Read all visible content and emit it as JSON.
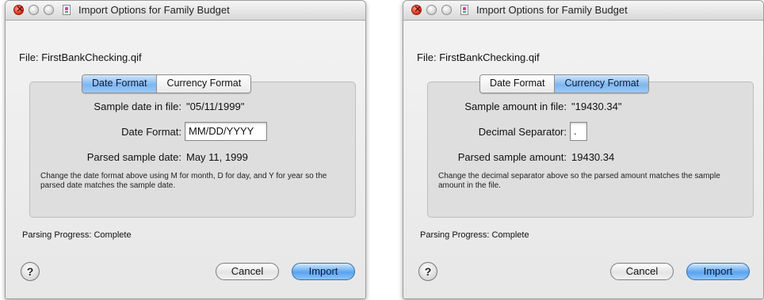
{
  "left_window": {
    "title": "Import Options for Family Budget",
    "file_label": "File:",
    "file_name": "FirstBankChecking.qif",
    "tabs": [
      "Date Format",
      "Currency Format"
    ],
    "active_tab": "Date Format",
    "sample_label": "Sample date in file:",
    "sample_value": "\"05/11/1999\"",
    "format_label": "Date Format:",
    "format_value": "MM/DD/YYYY",
    "parsed_label": "Parsed sample date:",
    "parsed_value": "May 11, 1999",
    "help_text": "Change the date format above using M for month, D for day, and Y for year so the parsed date matches the sample date.",
    "progress_text": "Parsing Progress: Complete",
    "help_button": "?",
    "cancel_label": "Cancel",
    "import_label": "Import"
  },
  "right_window": {
    "title": "Import Options for Family Budget",
    "file_label": "File:",
    "file_name": "FirstBankChecking.qif",
    "tabs": [
      "Date Format",
      "Currency Format"
    ],
    "active_tab": "Currency Format",
    "sample_label": "Sample amount in file:",
    "sample_value": "\"19430.34\"",
    "separator_label": "Decimal Separator:",
    "separator_value": ".",
    "parsed_label": "Parsed sample amount:",
    "parsed_value": "19430.34",
    "help_text": "Change the decimal separator above so the parsed amount matches the sample amount in the file.",
    "progress_text": "Parsing Progress: Complete",
    "help_button": "?",
    "cancel_label": "Cancel",
    "import_label": "Import"
  },
  "colors": {
    "active_tab": "#7fb6ee",
    "default_button": "#5aa3ef",
    "close_button": "#d42a12"
  },
  "icons": [
    "close-icon",
    "minimize-icon",
    "zoom-icon",
    "document-icon",
    "help-icon"
  ]
}
